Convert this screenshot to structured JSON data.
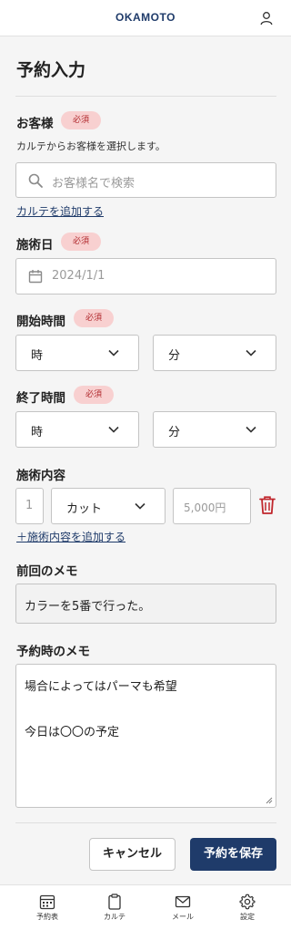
{
  "header": {
    "logo": "OKAMOTO",
    "user_icon": "user-icon"
  },
  "page": {
    "title": "予約入力"
  },
  "required_badge": "必須",
  "customer": {
    "label": "お客様",
    "helper": "カルテからお客様を選択します。",
    "search_placeholder": "お客様名で検索",
    "add_link": "カルテを追加する"
  },
  "treatment_date": {
    "label": "施術日",
    "placeholder": "2024/1/1"
  },
  "start_time": {
    "label": "開始時間",
    "hour": "時",
    "minute": "分"
  },
  "end_time": {
    "label": "終了時間",
    "hour": "時",
    "minute": "分"
  },
  "treatment": {
    "label": "施術内容",
    "quantity": "1",
    "menu": "カット",
    "price_placeholder": "5,000円",
    "add_link": "＋施術内容を追加する"
  },
  "previous_memo": {
    "label": "前回のメモ",
    "text": "カラーを5番で行った。"
  },
  "booking_memo": {
    "label": "予約時のメモ",
    "line1": "場合によってはパーマも希望",
    "line2": "今日は〇〇の予定"
  },
  "actions": {
    "cancel": "キャンセル",
    "save": "予約を保存"
  },
  "nav": [
    {
      "label": "予約表",
      "icon": "calendar-icon"
    },
    {
      "label": "カルテ",
      "icon": "clipboard-icon"
    },
    {
      "label": "メール",
      "icon": "mail-icon"
    },
    {
      "label": "設定",
      "icon": "gear-icon"
    }
  ],
  "colors": {
    "brand": "#1f3b6a",
    "badge_bg": "#f8d0d0",
    "badge_text": "#b0282c",
    "danger": "#c0262c"
  }
}
